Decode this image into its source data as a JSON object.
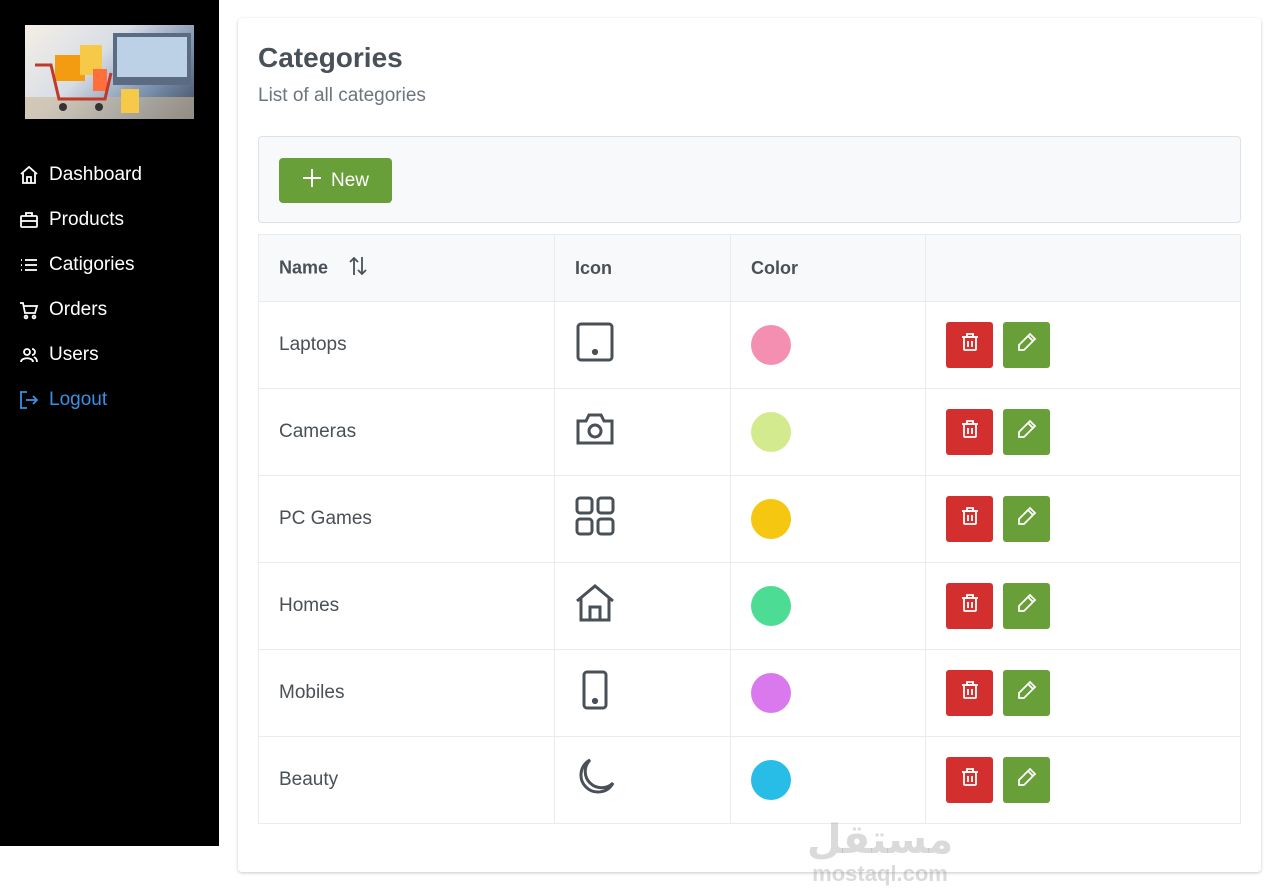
{
  "sidebar": {
    "logo_alt": "shopping cart image",
    "items": [
      {
        "label": "Dashboard",
        "icon": "home-icon"
      },
      {
        "label": "Products",
        "icon": "briefcase-icon"
      },
      {
        "label": "Catigories",
        "icon": "list-icon"
      },
      {
        "label": "Orders",
        "icon": "cart-icon"
      },
      {
        "label": "Users",
        "icon": "users-icon"
      },
      {
        "label": "Logout",
        "icon": "sign-out-icon"
      }
    ]
  },
  "page": {
    "title": "Categories",
    "subtitle": "List of all categories"
  },
  "toolbar": {
    "new_label": "New"
  },
  "table": {
    "columns": [
      "Name",
      "Icon",
      "Color",
      ""
    ],
    "rows": [
      {
        "name": "Laptops",
        "icon": "tablet-icon",
        "color": "#f48fb1"
      },
      {
        "name": "Cameras",
        "icon": "camera-icon",
        "color": "#d4ea8e"
      },
      {
        "name": "PC Games",
        "icon": "grid-icon",
        "color": "#f5c710"
      },
      {
        "name": "Homes",
        "icon": "home-icon",
        "color": "#4ddc93"
      },
      {
        "name": "Mobiles",
        "icon": "mobile-icon",
        "color": "#d979ed"
      },
      {
        "name": "Beauty",
        "icon": "moon-icon",
        "color": "#27bde6"
      }
    ]
  },
  "colors": {
    "sidebar_bg": "#000000",
    "accent_green": "#689f38",
    "danger_red": "#d32f2f",
    "logout_blue": "#3b8fe6"
  },
  "watermark": {
    "arabic": "مستقل",
    "latin": "mostaql.com"
  }
}
